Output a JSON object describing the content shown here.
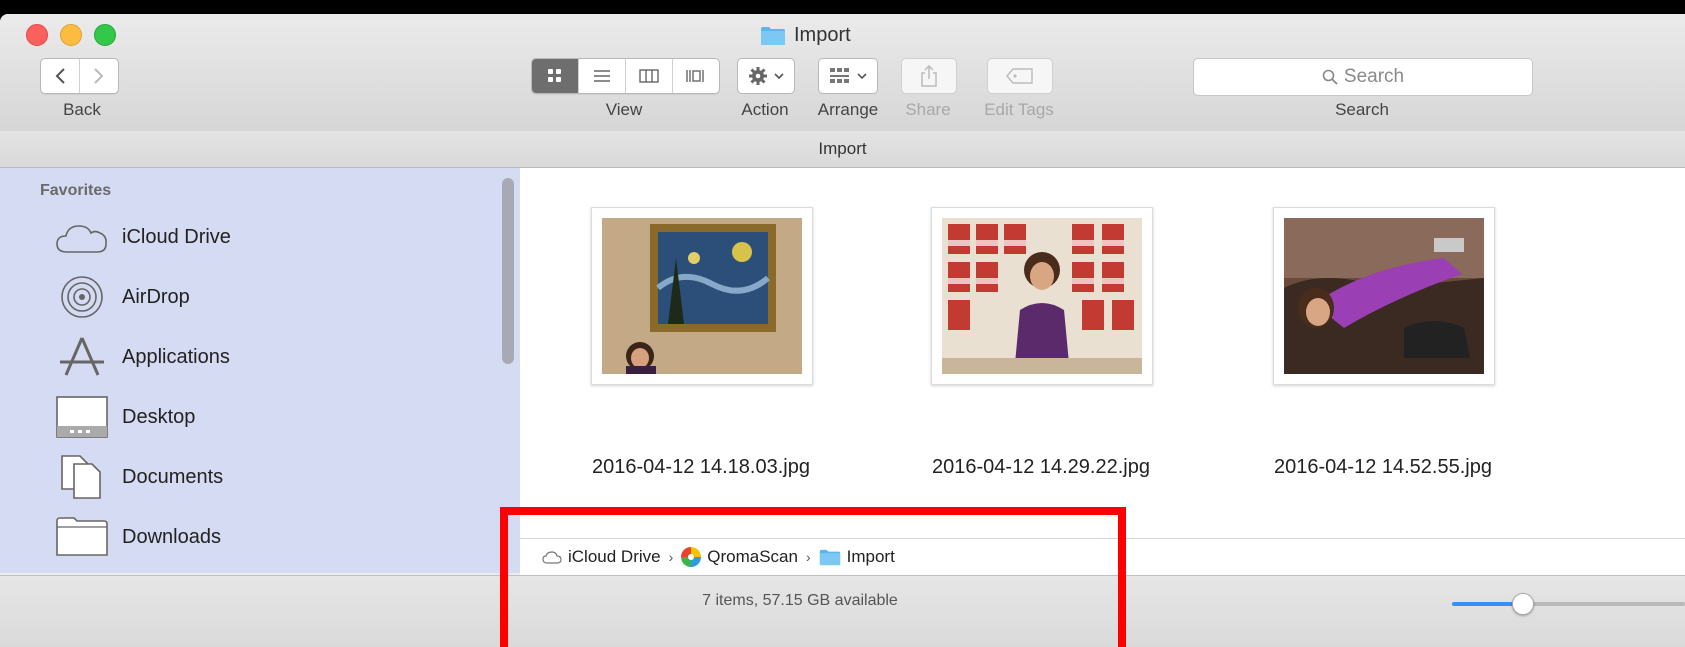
{
  "window": {
    "title": "Import"
  },
  "toolbar": {
    "back_label": "Back",
    "view_label": "View",
    "action_label": "Action",
    "arrange_label": "Arrange",
    "share_label": "Share",
    "edit_tags_label": "Edit Tags",
    "search_placeholder": "Search",
    "search_label": "Search"
  },
  "path_header": {
    "title": "Import"
  },
  "sidebar": {
    "section_title": "Favorites",
    "items": [
      {
        "label": "iCloud Drive",
        "icon": "cloud-icon"
      },
      {
        "label": "AirDrop",
        "icon": "airdrop-icon"
      },
      {
        "label": "Applications",
        "icon": "applications-icon"
      },
      {
        "label": "Desktop",
        "icon": "desktop-icon"
      },
      {
        "label": "Documents",
        "icon": "documents-icon"
      },
      {
        "label": "Downloads",
        "icon": "downloads-icon"
      }
    ]
  },
  "files": [
    {
      "name": "2016-04-12 14.18.03.jpg"
    },
    {
      "name": "2016-04-12 14.29.22.jpg"
    },
    {
      "name": "2016-04-12 14.52.55.jpg"
    }
  ],
  "breadcrumb": {
    "items": [
      {
        "label": "iCloud Drive",
        "icon": "cloud-icon"
      },
      {
        "label": "QromaScan",
        "icon": "qromascan-icon"
      },
      {
        "label": "Import",
        "icon": "folder-icon"
      }
    ]
  },
  "status": {
    "text": "7 items, 57.15 GB available",
    "zoom_fraction": 0.3
  },
  "colors": {
    "accent": "#3b8ef6",
    "sidebar_bg": "#d5dbf2",
    "highlight": "#ff0000"
  }
}
